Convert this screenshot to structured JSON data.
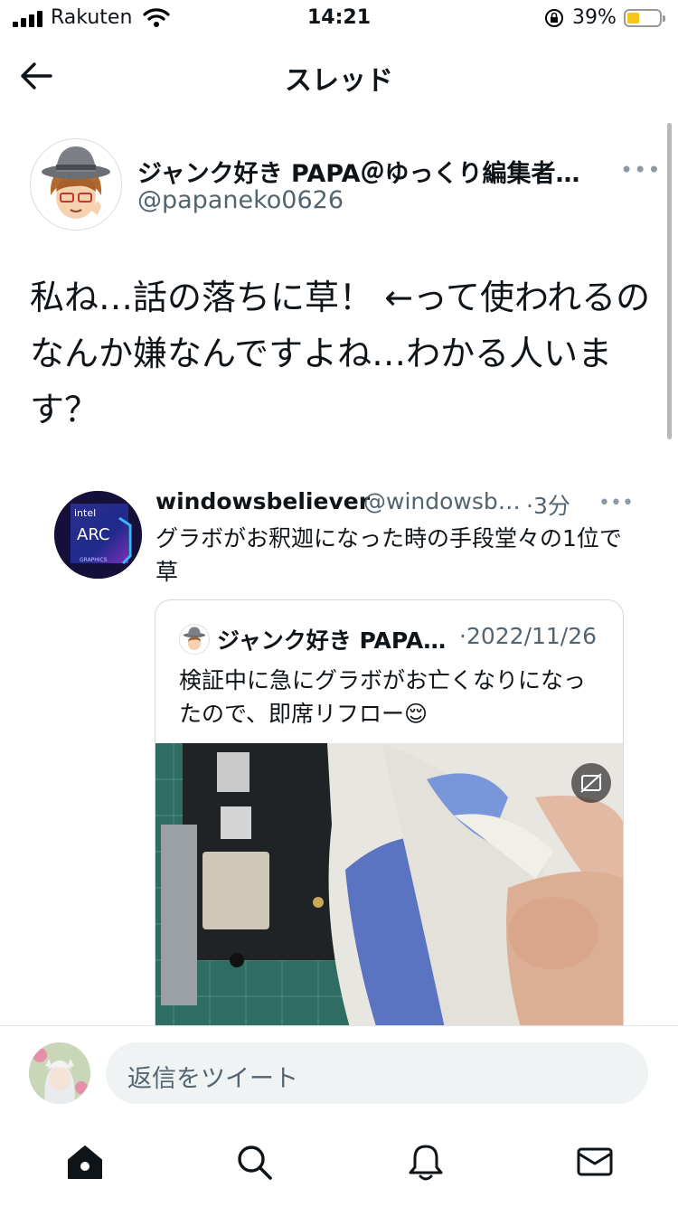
{
  "status_bar": {
    "carrier": "Rakuten",
    "time": "14:21",
    "battery_percent": "39%",
    "battery_level": 0.39
  },
  "header": {
    "title": "スレッド",
    "back_icon": "arrow-left-icon"
  },
  "main_tweet": {
    "author_name": "ジャンク好き PAPA＠ゆっくり編集者…",
    "author_handle": "@papaneko0626",
    "more_icon": "more-horizontal-icon",
    "text": "私ね…話の落ちに草！ ←って使われるのなんか嫌なんですよね…わかる人います？"
  },
  "quote_tweet": {
    "author_name": "windowsbeliever",
    "author_handle": "@windowsb…",
    "time": "·3分",
    "more_icon": "more-horizontal-icon",
    "avatar_text": {
      "brand": "intel",
      "product": "ARC",
      "sub": "GRAPHICS"
    },
    "text": "グラボがお釈迦になった時の手段堂々の1位で草",
    "nested": {
      "author_name": "ジャンク好き PAPA…",
      "date": "·2022/11/26",
      "text": "検証中に急にグラボがお亡くなりになったので、即席リフロー😌",
      "media_icon": "closed-caption-icon"
    }
  },
  "reply": {
    "placeholder": "返信をツイート"
  },
  "bottom_nav": [
    {
      "name": "home",
      "icon": "home-icon"
    },
    {
      "name": "search",
      "icon": "search-icon"
    },
    {
      "name": "notifications",
      "icon": "bell-icon"
    },
    {
      "name": "messages",
      "icon": "mail-icon"
    }
  ],
  "colors": {
    "text_primary": "#0f1419",
    "text_secondary": "#536471",
    "border": "#cfd9de",
    "reply_bg": "#eff3f4",
    "battery_fill": "#f5c518"
  }
}
